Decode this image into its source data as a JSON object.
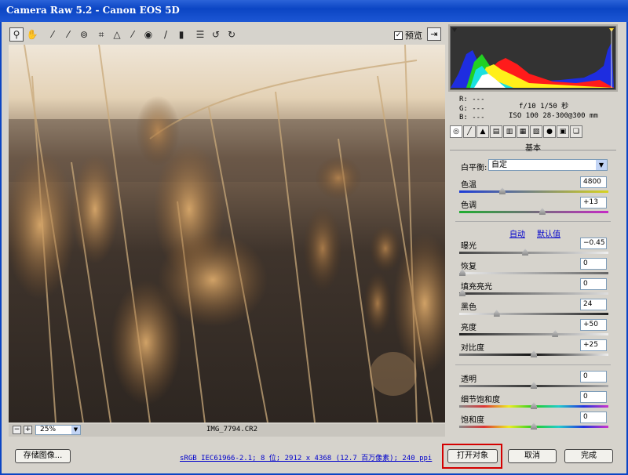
{
  "window": {
    "title": "Camera Raw 5.2 -  Canon EOS 5D"
  },
  "toolbar": {
    "tools": [
      "zoom-icon",
      "hand-icon",
      "white-balance-icon",
      "color-sampler-icon",
      "target-adjust-icon",
      "crop-icon",
      "straighten-icon",
      "spot-removal-icon",
      "red-eye-icon",
      "adjustment-brush-icon",
      "graduated-filter-icon",
      "preferences-icon",
      "rotate-ccw-icon",
      "rotate-cw-icon"
    ],
    "preview_label": "预览",
    "preview_checked": true
  },
  "status": {
    "zoom": "25%",
    "filename": "IMG_7794.CR2"
  },
  "info": {
    "r": "R:  ---",
    "g": "G:  ---",
    "b": "B:  ---",
    "aperture": "f/10  1/50 秒",
    "iso": "ISO 100  28-300@300 mm"
  },
  "panel": {
    "title": "基本",
    "wb_label": "白平衡:",
    "wb_value": "自定",
    "auto": "自动",
    "default": "默认值",
    "sliders": [
      {
        "label": "色温",
        "value": "4800",
        "pos": 0.28
      },
      {
        "label": "色调",
        "value": "+13",
        "pos": 0.56
      },
      {
        "label": "曝光",
        "value": "−0.45",
        "pos": 0.44
      },
      {
        "label": "恢复",
        "value": "0",
        "pos": 0.0
      },
      {
        "label": "填充亮光",
        "value": "0",
        "pos": 0.0
      },
      {
        "label": "黑色",
        "value": "24",
        "pos": 0.24
      },
      {
        "label": "亮度",
        "value": "+50",
        "pos": 0.65
      },
      {
        "label": "对比度",
        "value": "+25",
        "pos": 0.5
      },
      {
        "label": "透明",
        "value": "0",
        "pos": 0.5
      },
      {
        "label": "细节饱和度",
        "value": "0",
        "pos": 0.5
      },
      {
        "label": "饱和度",
        "value": "0",
        "pos": 0.5
      }
    ]
  },
  "footer": {
    "save": "存储图像...",
    "workflow": "sRGB IEC61966-2.1; 8 位; 2912 x 4368 (12.7 百万像素); 240 ppi",
    "open": "打开对象",
    "cancel": "取消",
    "done": "完成"
  }
}
